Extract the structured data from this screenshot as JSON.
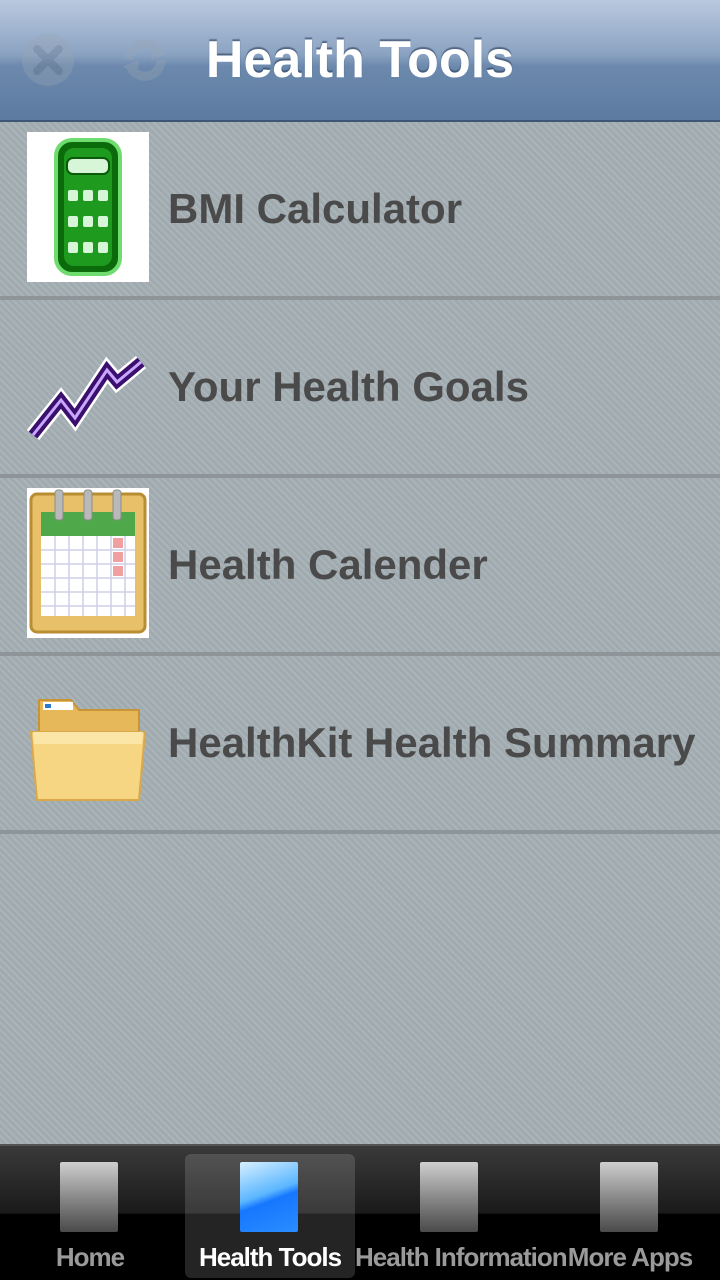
{
  "header": {
    "title": "Health Tools",
    "left_buttons": [
      "close-icon",
      "refresh-icon"
    ]
  },
  "list": {
    "items": [
      {
        "label": "BMI Calculator",
        "icon": "calculator-icon"
      },
      {
        "label": "Your Health Goals",
        "icon": "trend-line-icon"
      },
      {
        "label": "Health Calender",
        "icon": "calendar-icon"
      },
      {
        "label": "HealthKit Health Summary",
        "icon": "folder-icon"
      }
    ]
  },
  "tabbar": {
    "tabs": [
      {
        "label": "Home",
        "active": false
      },
      {
        "label": "Health Tools",
        "active": true
      },
      {
        "label": "Health Information",
        "active": false
      },
      {
        "label": "More Apps",
        "active": false
      }
    ]
  },
  "colors": {
    "navbar": "#6c89ad",
    "background": "#a5b0b5",
    "label": "#4a4a4a",
    "tab_active": "#1677ff"
  }
}
